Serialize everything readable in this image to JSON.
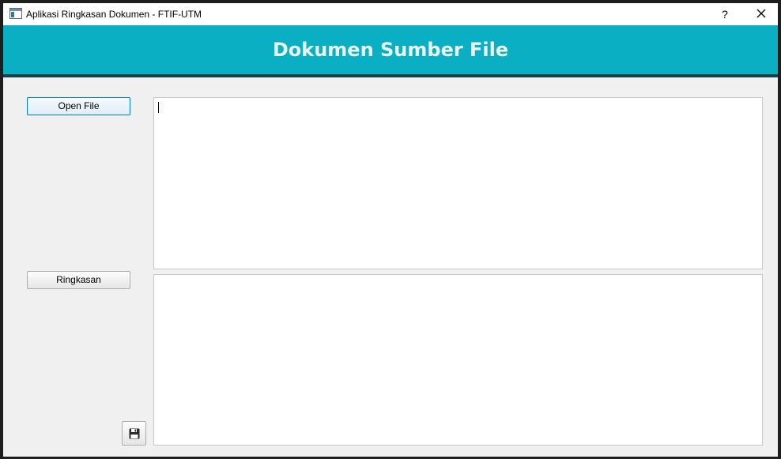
{
  "window": {
    "title": "Aplikasi Ringkasan Dokumen - FTIF-UTM",
    "help_label": "?",
    "icons": {
      "app": "window-app-icon",
      "close": "close-icon"
    }
  },
  "header": {
    "title": "Dokumen Sumber File",
    "colors": {
      "background": "#0aafc4",
      "text": "#e8f6f8",
      "underline": "#1f3d44"
    }
  },
  "controls": {
    "open_file_label": "Open File",
    "ringkasan_label": "Ringkasan",
    "save_icon": "floppy-disk-icon"
  },
  "editors": {
    "source_text": "",
    "summary_text": ""
  }
}
